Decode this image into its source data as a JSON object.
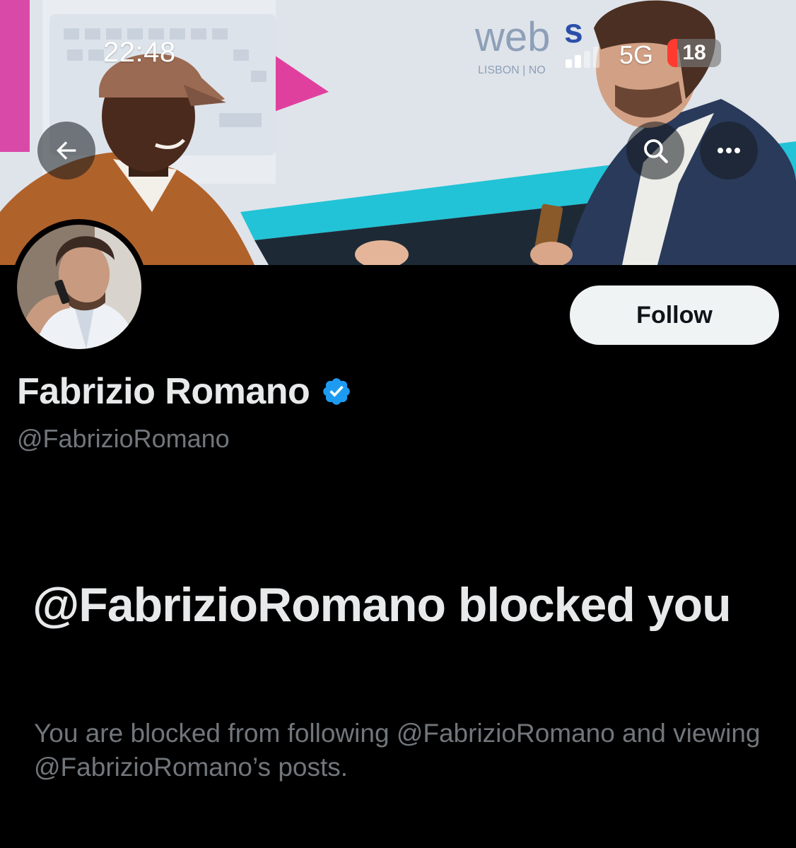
{
  "status_bar": {
    "time": "22:48",
    "network": "5G",
    "battery": "18",
    "battery_level": 0.18
  },
  "banner": {
    "background_text": "web s",
    "background_subtext": "LISBON | NO"
  },
  "profile": {
    "display_name": "Fabrizio Romano",
    "handle": "@FabrizioRomano",
    "follow_label": "Follow"
  },
  "blocked": {
    "title": "@FabrizioRomano blocked you",
    "description": "You are blocked from following @FabrizioRomano and viewing @FabrizioRomano’s posts."
  },
  "colors": {
    "background": "#000000",
    "text_primary": "#e7e9ea",
    "text_secondary": "#71767b",
    "verified_blue": "#1d9bf0",
    "follow_bg": "#eff3f4",
    "battery_red": "#ff3b30"
  },
  "icons": {
    "back": "arrow-left-icon",
    "search": "search-icon",
    "more": "more-horizontal-icon",
    "verified": "verified-badge-icon"
  }
}
